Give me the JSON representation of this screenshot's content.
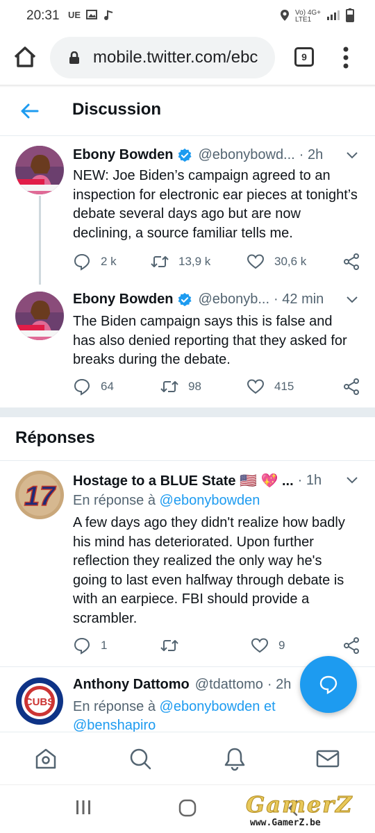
{
  "status_bar": {
    "time": "20:31",
    "left_icons": [
      "UE",
      "image-icon",
      "music-icon"
    ],
    "net_label": "Vo) 4G+",
    "net_sub": "LTE1"
  },
  "browser": {
    "url": "mobile.twitter.com/ebc",
    "tab_count": "9"
  },
  "header": {
    "title": "Discussion"
  },
  "tweets": [
    {
      "name": "Ebony Bowden",
      "handle": "@ebonybowd...",
      "time": "· 2h",
      "text": "NEW: Joe Biden’s campaign agreed to an inspection for electronic ear pieces at tonight’s debate several days ago but are now declining, a source familiar tells me.",
      "replies": "2 k",
      "retweets": "13,9 k",
      "likes": "30,6 k"
    },
    {
      "name": "Ebony Bowden",
      "handle": "@ebonyb...",
      "time": "· 42 min",
      "text": "The Biden campaign says this is false and has also denied reporting that they asked for breaks during the debate.",
      "replies": "64",
      "retweets": "98",
      "likes": "415"
    }
  ],
  "replies_section": {
    "title": "Réponses"
  },
  "replies": [
    {
      "name": "Hostage to a BLUE State 🇺🇸 💖 ...",
      "time": "· 1h",
      "reply_prefix": "En réponse à",
      "reply_to": "@ebonybowden",
      "text": "A few days ago they didn't realize how badly his mind has deteriorated. Upon further reflection they realized the only way he's going to last even halfway through debate is with an earpiece. FBI should provide a scrambler.",
      "replies": "1",
      "retweets": "",
      "likes": "9",
      "avatar_text": "17"
    },
    {
      "name": "Anthony Dattomo",
      "handle": "@tdattomo",
      "time": "· 2h",
      "reply_prefix": "En réponse à",
      "reply_to": "@ebonybowden",
      "reply_and": "et",
      "reply_to_2": "@benshapiro",
      "avatar_text": "CUBS"
    }
  ],
  "watermark": {
    "logo": "GamerZ",
    "url": "www.GamerZ.be"
  },
  "colors": {
    "accent": "#1d9bf0",
    "text": "#0f1419",
    "muted": "#536471"
  }
}
